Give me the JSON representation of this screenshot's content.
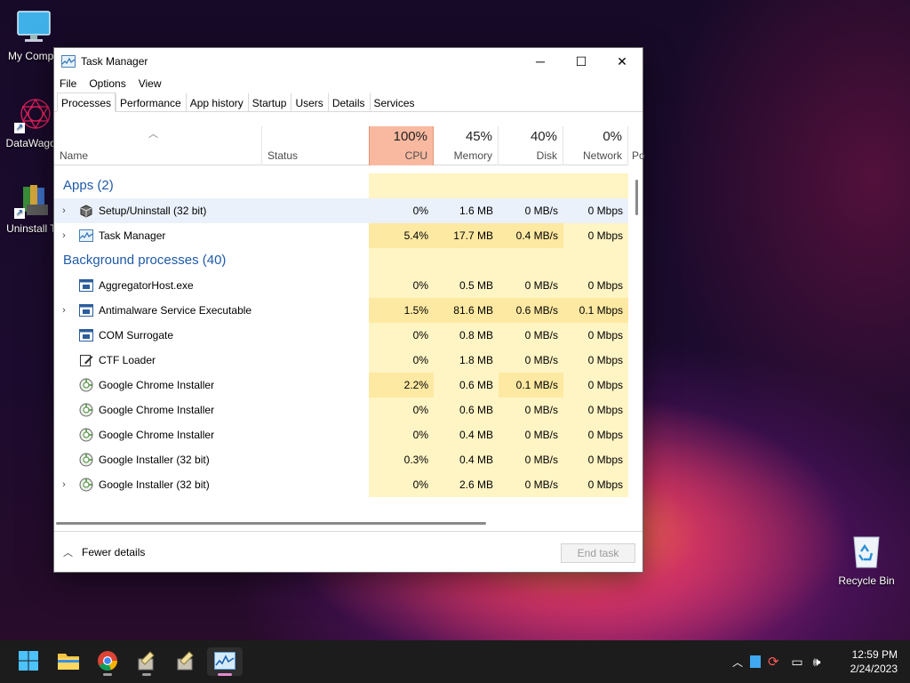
{
  "desktop": {
    "icons": [
      {
        "label": "My Compu",
        "icon": "monitor-icon"
      },
      {
        "label": "DataWagon",
        "icon": "datawagon-icon"
      },
      {
        "label": "Uninstall To",
        "icon": "uninstall-tool-icon"
      },
      {
        "label": "Recycle Bin",
        "icon": "recycle-bin-icon"
      }
    ]
  },
  "window": {
    "title": "Task Manager",
    "controls": {
      "minimize": "─",
      "maximize": "☐",
      "close": "✕"
    },
    "menu": [
      "File",
      "Options",
      "View"
    ],
    "tabs": [
      "Processes",
      "Performance",
      "App history",
      "Startup",
      "Users",
      "Details",
      "Services"
    ],
    "active_tab": "Processes",
    "columns": {
      "name": "Name",
      "status": "Status",
      "cpu": {
        "pct": "100%",
        "label": "CPU"
      },
      "memory": {
        "pct": "45%",
        "label": "Memory"
      },
      "disk": {
        "pct": "40%",
        "label": "Disk"
      },
      "network": {
        "pct": "0%",
        "label": "Network"
      },
      "power": {
        "label": "Po"
      }
    },
    "groups": {
      "apps": "Apps (2)",
      "background": "Background processes (40)"
    },
    "apps": [
      {
        "name": "Setup/Uninstall (32 bit)",
        "expandable": true,
        "icon": "setup-box-icon",
        "cpu": "0%",
        "memory": "1.6 MB",
        "disk": "0 MB/s",
        "network": "0 Mbps"
      },
      {
        "name": "Task Manager",
        "expandable": true,
        "icon": "task-manager-icon",
        "cpu": "5.4%",
        "memory": "17.7 MB",
        "disk": "0.4 MB/s",
        "network": "0 Mbps"
      }
    ],
    "background": [
      {
        "name": "AggregatorHost.exe",
        "expandable": false,
        "icon": "window-app-icon",
        "cpu": "0%",
        "memory": "0.5 MB",
        "disk": "0 MB/s",
        "network": "0 Mbps"
      },
      {
        "name": "Antimalware Service Executable",
        "expandable": true,
        "icon": "window-app-icon",
        "cpu": "1.5%",
        "memory": "81.6 MB",
        "disk": "0.6 MB/s",
        "network": "0.1 Mbps"
      },
      {
        "name": "COM Surrogate",
        "expandable": false,
        "icon": "window-app-icon",
        "cpu": "0%",
        "memory": "0.8 MB",
        "disk": "0 MB/s",
        "network": "0 Mbps"
      },
      {
        "name": "CTF Loader",
        "expandable": false,
        "icon": "pen-notepad-icon",
        "cpu": "0%",
        "memory": "1.8 MB",
        "disk": "0 MB/s",
        "network": "0 Mbps"
      },
      {
        "name": "Google Chrome Installer",
        "expandable": false,
        "icon": "installer-icon",
        "cpu": "2.2%",
        "memory": "0.6 MB",
        "disk": "0.1 MB/s",
        "network": "0 Mbps"
      },
      {
        "name": "Google Chrome Installer",
        "expandable": false,
        "icon": "installer-icon",
        "cpu": "0%",
        "memory": "0.6 MB",
        "disk": "0 MB/s",
        "network": "0 Mbps"
      },
      {
        "name": "Google Chrome Installer",
        "expandable": false,
        "icon": "installer-icon",
        "cpu": "0%",
        "memory": "0.4 MB",
        "disk": "0 MB/s",
        "network": "0 Mbps"
      },
      {
        "name": "Google Installer (32 bit)",
        "expandable": false,
        "icon": "installer-icon",
        "cpu": "0.3%",
        "memory": "0.4 MB",
        "disk": "0 MB/s",
        "network": "0 Mbps"
      },
      {
        "name": "Google Installer (32 bit)",
        "expandable": true,
        "icon": "installer-icon",
        "cpu": "0%",
        "memory": "2.6 MB",
        "disk": "0 MB/s",
        "network": "0 Mbps"
      }
    ],
    "footer": {
      "fewer_details": "Fewer details",
      "end_task": "End task"
    }
  },
  "taskbar": {
    "apps": [
      "start-icon",
      "file-explorer-icon",
      "chrome-icon",
      "installer-app-icon",
      "installer-app-icon",
      "task-manager-icon"
    ],
    "clock": {
      "time": "12:59 PM",
      "date": "2/24/2023"
    }
  },
  "colors": {
    "cpu_header": "#f9b9a0",
    "heat_light": "#fff4c4",
    "heat_medium": "#fde9a2",
    "group_text": "#1f5aa8"
  }
}
